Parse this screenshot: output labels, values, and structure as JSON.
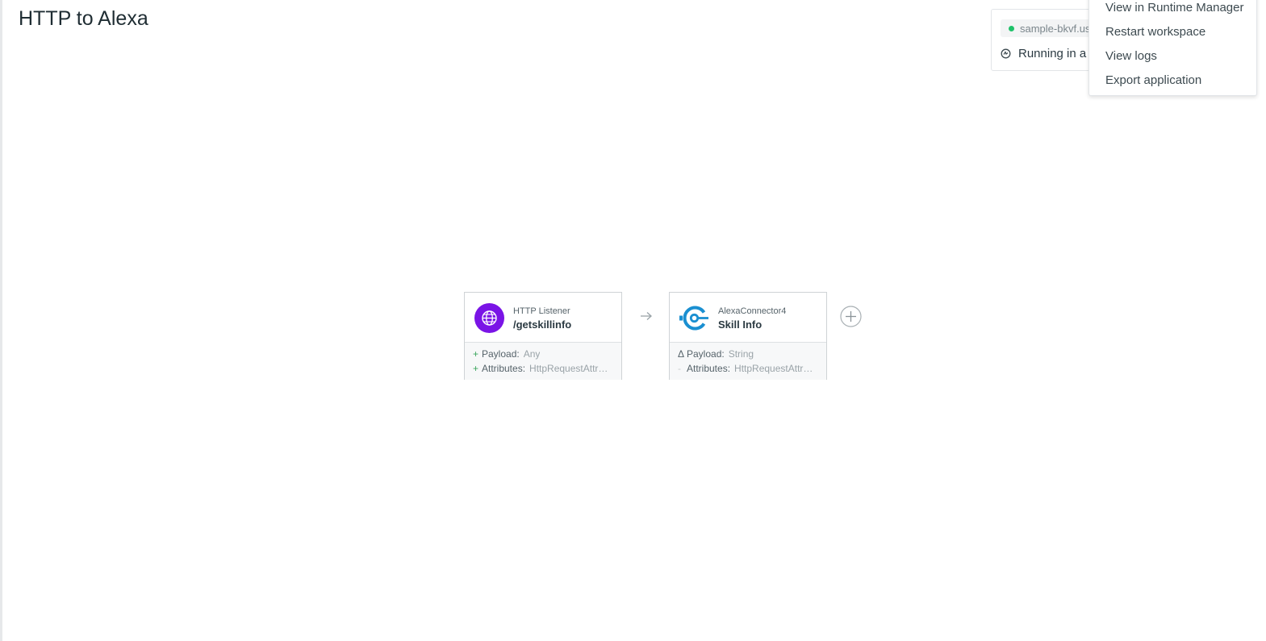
{
  "page": {
    "title": "HTTP to Alexa"
  },
  "status": {
    "domain": "sample-bkvf.us-",
    "running": "Running in a"
  },
  "menu": {
    "items": [
      {
        "label": "View in Runtime Manager"
      },
      {
        "label": "Restart workspace"
      },
      {
        "label": "View logs"
      },
      {
        "label": "Export application"
      }
    ]
  },
  "flow": {
    "nodes": [
      {
        "type": "HTTP Listener",
        "name": "/getskillinfo",
        "icon": "globe-icon",
        "icon_color": "#7a14e6",
        "meta": [
          {
            "symbol": "+",
            "key": "Payload:",
            "value": "Any"
          },
          {
            "symbol": "+",
            "key": "Attributes:",
            "value": "HttpRequestAttri…"
          }
        ]
      },
      {
        "type": "AlexaConnector4",
        "name": "Skill Info",
        "icon": "connector-icon",
        "icon_color": "#1a8fd1",
        "meta": [
          {
            "symbol": "Δ",
            "key": "Payload:",
            "value": "String"
          },
          {
            "symbol": "-",
            "key": "Attributes:",
            "value": "HttpRequestAttri…"
          }
        ]
      }
    ]
  },
  "colors": {
    "status_dot": "#1fc26a",
    "meta_added": "#3ba55c"
  }
}
